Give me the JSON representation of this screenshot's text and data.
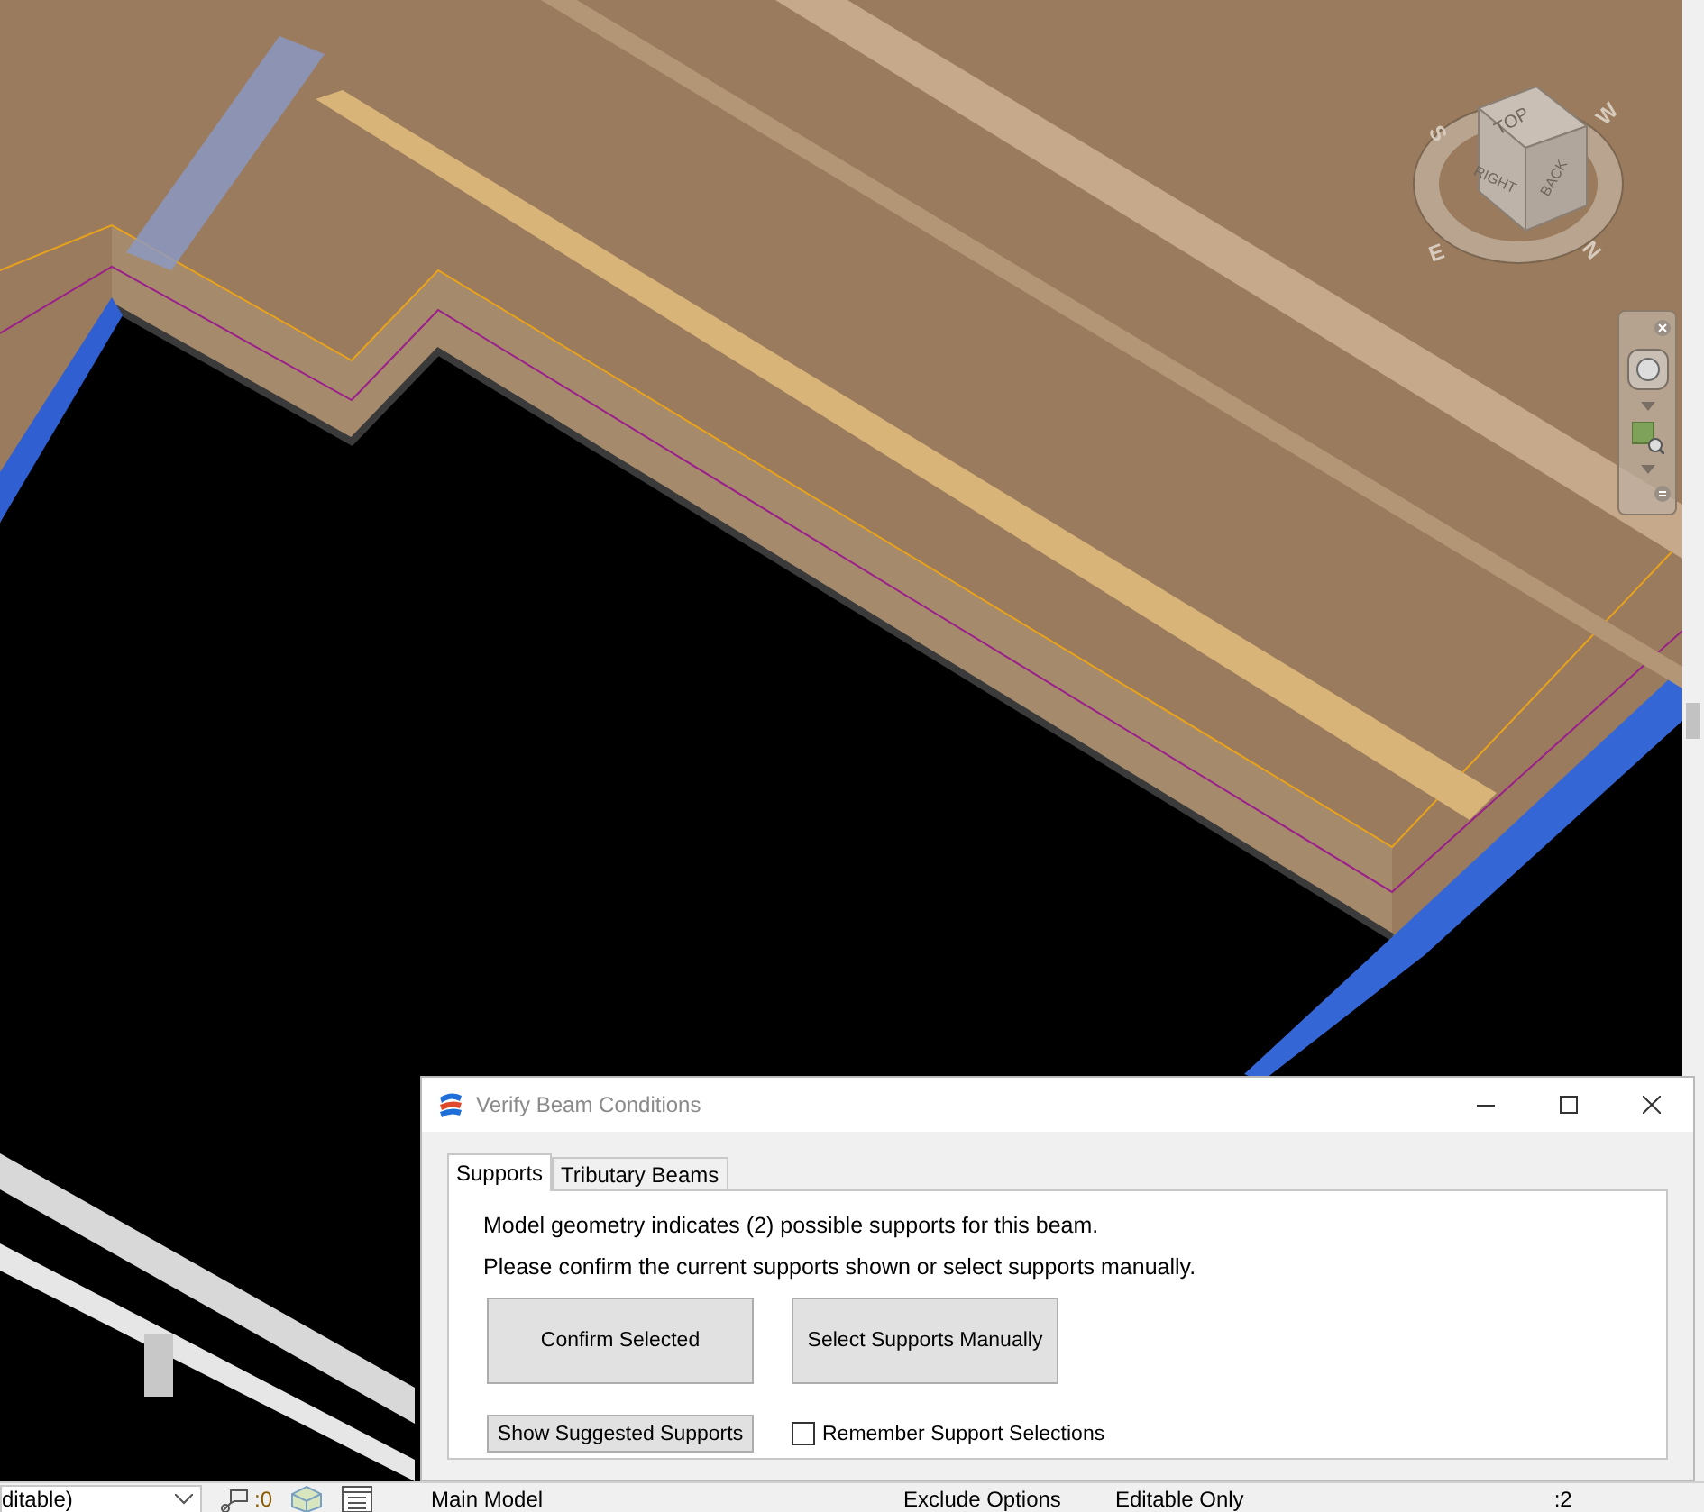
{
  "viewport": {
    "view_cube": {
      "faces": [
        "TOP",
        "RIGHT",
        "BACK"
      ],
      "compass": [
        "S",
        "W",
        "E",
        "N"
      ]
    }
  },
  "dialog": {
    "title": "Verify Beam Conditions",
    "tabs": [
      {
        "label": "Supports",
        "selected": true
      },
      {
        "label": "Tributary Beams",
        "selected": false
      }
    ],
    "messages": [
      "Model geometry indicates (2) possible supports for this beam.",
      "Please confirm the current supports shown or select supports manually."
    ],
    "buttons": [
      "Confirm Selected",
      "Select Supports Manually"
    ],
    "show_button": "Show Suggested Supports",
    "remember": {
      "label": "Remember Support Selections",
      "checked": false
    }
  },
  "status_bar": {
    "workset": "ditable)",
    "count": ":0",
    "model": "Main Model",
    "options": "Exclude Options",
    "editable": "Editable Only",
    "filter_count": ":2"
  }
}
